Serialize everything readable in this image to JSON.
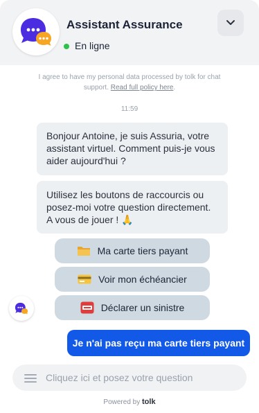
{
  "header": {
    "title": "Assistant Assurance",
    "status": "En ligne",
    "status_color": "#2fc24b",
    "avatar_icon": "chat-bubbles-icon",
    "collapse_icon": "chevron-down-icon"
  },
  "consent": {
    "text": "I agree to have my personal data processed by tolk for chat support.",
    "link": "Read full policy here",
    "suffix": "."
  },
  "messages": {
    "time": "11:59",
    "bot": [
      "Bonjour Antoine, je suis Assuria, votre assistant virtuel. Comment puis-je vous aider aujourd'hui ?",
      "Utilisez les boutons de raccourcis ou posez-moi votre question directement. A vous de jouer ! 🙏"
    ],
    "quick_replies": [
      {
        "icon": "folder-icon",
        "label": "Ma carte tiers payant"
      },
      {
        "icon": "credit-card-icon",
        "label": "Voir mon échéancier"
      },
      {
        "icon": "sos-icon",
        "label": "Déclarer un sinistre"
      }
    ],
    "user": "Je n'ai pas reçu ma carte tiers payant"
  },
  "composer": {
    "placeholder": "Cliquez ici et posez votre question",
    "menu_icon": "menu-icon"
  },
  "footer": {
    "powered_by": "Powered by",
    "brand": "tolk"
  },
  "colors": {
    "header_bg": "#f2f3f5",
    "bot_bubble": "#edf0f3",
    "quick_reply": "#ced9e1",
    "user_bubble": "#1259e8",
    "avatar_purple": "#4b2ce0",
    "avatar_orange": "#f6a623"
  }
}
